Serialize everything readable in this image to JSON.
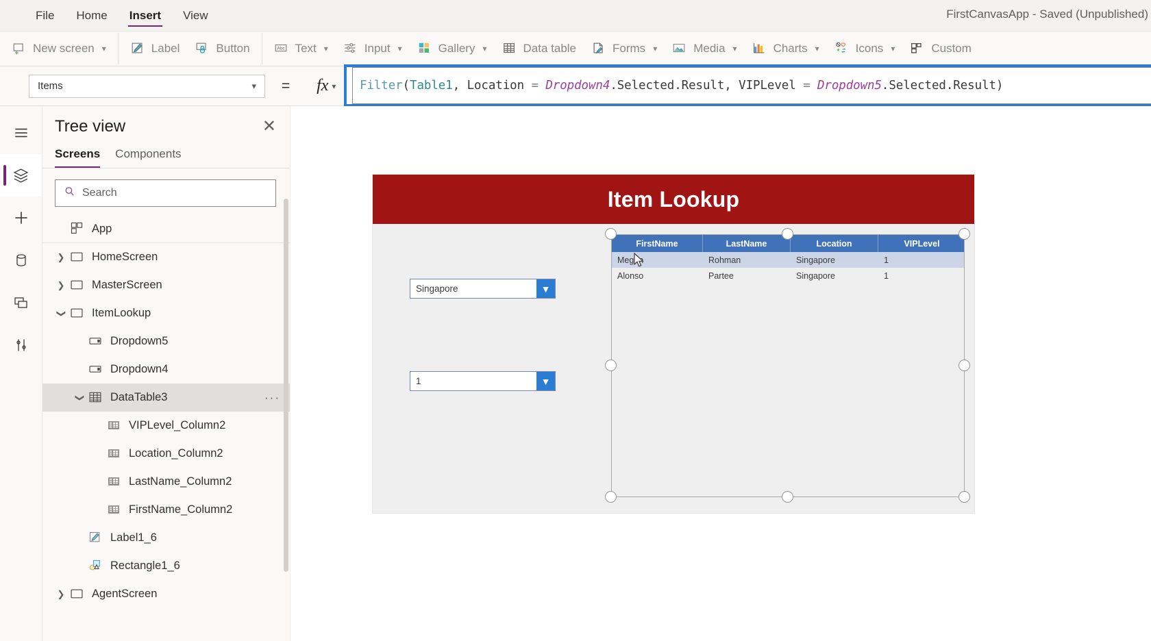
{
  "titlebar": {
    "menus": [
      {
        "label": "File",
        "active": false
      },
      {
        "label": "Home",
        "active": false
      },
      {
        "label": "Insert",
        "active": true
      },
      {
        "label": "View",
        "active": false
      }
    ],
    "app_title": "FirstCanvasApp - Saved (Unpublished)"
  },
  "ribbon": {
    "groups": [
      {
        "items": [
          {
            "label": "New screen",
            "icon": "new-screen-icon",
            "caret": true
          }
        ]
      },
      {
        "items": [
          {
            "label": "Label",
            "icon": "label-icon",
            "caret": false
          },
          {
            "label": "Button",
            "icon": "button-icon",
            "caret": false
          }
        ]
      },
      {
        "items": [
          {
            "label": "Text",
            "icon": "text-icon",
            "caret": true
          },
          {
            "label": "Input",
            "icon": "input-icon",
            "caret": true
          },
          {
            "label": "Gallery",
            "icon": "gallery-icon",
            "caret": true
          },
          {
            "label": "Data table",
            "icon": "data-table-icon",
            "caret": false
          },
          {
            "label": "Forms",
            "icon": "forms-icon",
            "caret": true
          },
          {
            "label": "Media",
            "icon": "media-icon",
            "caret": true
          },
          {
            "label": "Charts",
            "icon": "charts-icon",
            "caret": true
          },
          {
            "label": "Icons",
            "icon": "icons-icon",
            "caret": true
          },
          {
            "label": "Custom",
            "icon": "custom-icon",
            "caret": false
          }
        ]
      }
    ]
  },
  "formula_bar": {
    "property": "Items",
    "equals": "=",
    "fx_label": "fx",
    "formula_plain": "Filter(Table1, Location = Dropdown4.Selected.Result, VIPLevel = Dropdown5.Selected.Result)",
    "tokens": [
      {
        "t": "Filter",
        "k": "fn"
      },
      {
        "t": "(",
        "k": "paren"
      },
      {
        "t": "Table1",
        "k": "table"
      },
      {
        "t": ", ",
        "k": "plain"
      },
      {
        "t": "Location",
        "k": "plain"
      },
      {
        "t": " ",
        "k": "plain"
      },
      {
        "t": "=",
        "k": "op"
      },
      {
        "t": " ",
        "k": "plain"
      },
      {
        "t": "Dropdown4",
        "k": "ctrl"
      },
      {
        "t": ".Selected.Result",
        "k": "plain"
      },
      {
        "t": ", ",
        "k": "plain"
      },
      {
        "t": "VIPLevel",
        "k": "plain"
      },
      {
        "t": " ",
        "k": "plain"
      },
      {
        "t": "=",
        "k": "op"
      },
      {
        "t": " ",
        "k": "plain"
      },
      {
        "t": "Dropdown5",
        "k": "ctrl"
      },
      {
        "t": ".Selected.Result",
        "k": "plain"
      },
      {
        "t": ")",
        "k": "paren"
      }
    ]
  },
  "rail": {
    "items": [
      {
        "name": "hamburger-menu-icon",
        "selected": false
      },
      {
        "name": "tree-view-icon",
        "selected": true
      },
      {
        "name": "insert-plus-icon",
        "selected": false
      },
      {
        "name": "data-sources-icon",
        "selected": false
      },
      {
        "name": "media-library-icon",
        "selected": false
      },
      {
        "name": "advanced-tools-icon",
        "selected": false
      }
    ]
  },
  "tree_panel": {
    "title": "Tree view",
    "close_label": "✕",
    "tabs": [
      {
        "label": "Screens",
        "active": true
      },
      {
        "label": "Components",
        "active": false
      }
    ],
    "search_placeholder": "Search",
    "search_value": "",
    "rows": [
      {
        "label": "App",
        "indent": 0,
        "twisty": "",
        "icon": "app-icon",
        "selected": false,
        "divider": true,
        "more": false
      },
      {
        "label": "HomeScreen",
        "indent": 0,
        "twisty": "collapsed",
        "icon": "screen-icon",
        "selected": false,
        "divider": false,
        "more": false
      },
      {
        "label": "MasterScreen",
        "indent": 0,
        "twisty": "collapsed",
        "icon": "screen-icon",
        "selected": false,
        "divider": false,
        "more": false
      },
      {
        "label": "ItemLookup",
        "indent": 0,
        "twisty": "expanded",
        "icon": "screen-icon",
        "selected": false,
        "divider": false,
        "more": false
      },
      {
        "label": "Dropdown5",
        "indent": 1,
        "twisty": "",
        "icon": "dropdown-icon",
        "selected": false,
        "divider": false,
        "more": false
      },
      {
        "label": "Dropdown4",
        "indent": 1,
        "twisty": "",
        "icon": "dropdown-icon",
        "selected": false,
        "divider": false,
        "more": false
      },
      {
        "label": "DataTable3",
        "indent": 1,
        "twisty": "expanded",
        "icon": "datatable-icon",
        "selected": true,
        "divider": false,
        "more": true
      },
      {
        "label": "VIPLevel_Column2",
        "indent": 2,
        "twisty": "",
        "icon": "column-icon",
        "selected": false,
        "divider": false,
        "more": false
      },
      {
        "label": "Location_Column2",
        "indent": 2,
        "twisty": "",
        "icon": "column-icon",
        "selected": false,
        "divider": false,
        "more": false
      },
      {
        "label": "LastName_Column2",
        "indent": 2,
        "twisty": "",
        "icon": "column-icon",
        "selected": false,
        "divider": false,
        "more": false
      },
      {
        "label": "FirstName_Column2",
        "indent": 2,
        "twisty": "",
        "icon": "column-icon",
        "selected": false,
        "divider": false,
        "more": false
      },
      {
        "label": "Label1_6",
        "indent": 1,
        "twisty": "",
        "icon": "label-tree-icon",
        "selected": false,
        "divider": false,
        "more": false
      },
      {
        "label": "Rectangle1_6",
        "indent": 1,
        "twisty": "",
        "icon": "shape-icon",
        "selected": false,
        "divider": false,
        "more": false
      },
      {
        "label": "AgentScreen",
        "indent": 0,
        "twisty": "collapsed",
        "icon": "screen-icon",
        "selected": false,
        "divider": false,
        "more": false
      }
    ],
    "more_label": "···"
  },
  "canvas": {
    "app": {
      "banner_title": "Item Lookup",
      "banner_color": "#a01414",
      "dropdowns": [
        {
          "id": "dd-location",
          "value": "Singapore",
          "arrow": "▼"
        },
        {
          "id": "dd-vip",
          "value": "1",
          "arrow": "▼"
        }
      ],
      "data_table": {
        "columns": [
          "FirstName",
          "LastName",
          "Location",
          "VIPLevel"
        ],
        "header_color": "#3f72b8",
        "rows": [
          [
            "Megan",
            "Rohman",
            "Singapore",
            "1"
          ],
          [
            "Alonso",
            "Partee",
            "Singapore",
            "1"
          ]
        ]
      }
    }
  }
}
